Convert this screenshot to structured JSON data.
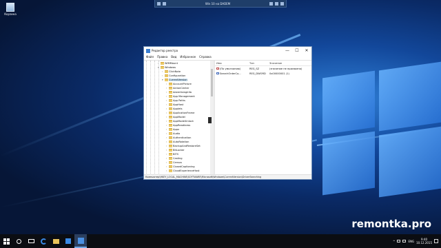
{
  "colors": {
    "desktop_blue": "#12479a",
    "accent": "#4a90e2",
    "selection": "#cce4f7",
    "taskbar": "#0b0d12"
  },
  "rdp_bar": {
    "title": "Win 10 на DADEM",
    "icons": [
      "pin-icon",
      "signal-icon",
      "minimize-icon",
      "restore-icon",
      "close-icon"
    ]
  },
  "desktop": {
    "recycle_bin_label": "Корзина",
    "watermark": "remontka.pro"
  },
  "window": {
    "title": "Редактор реестра",
    "controls": [
      "—",
      "☐",
      "✕"
    ],
    "menu": [
      "Файл",
      "Правка",
      "Вид",
      "Избранное",
      "Справка"
    ],
    "tree": [
      {
        "label": "WIMMount",
        "level": 0,
        "expanded": false
      },
      {
        "label": "Windows",
        "level": 0,
        "expanded": true
      },
      {
        "label": "ClickNote",
        "level": 1,
        "expanded": false
      },
      {
        "label": "Configuration",
        "level": 1,
        "expanded": false
      },
      {
        "label": "CurrentVersion",
        "level": 1,
        "expanded": true
      },
      {
        "label": "AccountPicture",
        "level": 2,
        "expanded": false
      },
      {
        "label": "ActionCenter",
        "level": 2,
        "expanded": false
      },
      {
        "label": "AdvertisingInfo",
        "level": 2,
        "expanded": false
      },
      {
        "label": "App Management",
        "level": 2,
        "expanded": false
      },
      {
        "label": "App Paths",
        "level": 2,
        "expanded": false
      },
      {
        "label": "AppHost",
        "level": 2,
        "expanded": false
      },
      {
        "label": "Applets",
        "level": 2,
        "expanded": false
      },
      {
        "label": "ApplicationFrame",
        "level": 2,
        "expanded": false
      },
      {
        "label": "AppModel",
        "level": 2,
        "expanded": false
      },
      {
        "label": "AppModelUnlock",
        "level": 2,
        "expanded": false
      },
      {
        "label": "AppReadiness",
        "level": 2,
        "expanded": false
      },
      {
        "label": "Appx",
        "level": 2,
        "expanded": false
      },
      {
        "label": "Audio",
        "level": 2,
        "expanded": false
      },
      {
        "label": "Authentication",
        "level": 2,
        "expanded": false
      },
      {
        "label": "AutoRotation",
        "level": 2,
        "expanded": false
      },
      {
        "label": "BackupAndRestoreSet",
        "level": 2,
        "expanded": false
      },
      {
        "label": "BitLocker",
        "level": 2,
        "expanded": false
      },
      {
        "label": "BITS",
        "level": 2,
        "expanded": false
      },
      {
        "label": "Casting",
        "level": 2,
        "expanded": false
      },
      {
        "label": "Census",
        "level": 2,
        "expanded": false
      },
      {
        "label": "ClosedCaptioning",
        "level": 2,
        "expanded": false
      },
      {
        "label": "CloudExperienceHost",
        "level": 2,
        "expanded": false
      }
    ],
    "columns": [
      "Имя",
      "Тип",
      "Значение"
    ],
    "values": [
      {
        "name": "(По умолчанию)",
        "type": "REG_SZ",
        "data": "(значение не присвоено)",
        "icon": "string-value-icon"
      },
      {
        "name": "SearchOrderCo...",
        "type": "REG_DWORD",
        "data": "0x00000001 (1)",
        "icon": "dword-value-icon"
      }
    ],
    "status_path": "Компьютер\\HKEY_LOCAL_MACHINE\\SOFTWARE\\Microsoft\\Windows\\CurrentVersion\\DriverSearching"
  },
  "taskbar": {
    "language": "ENG",
    "time": "9:40",
    "date": "10.12.2015"
  }
}
